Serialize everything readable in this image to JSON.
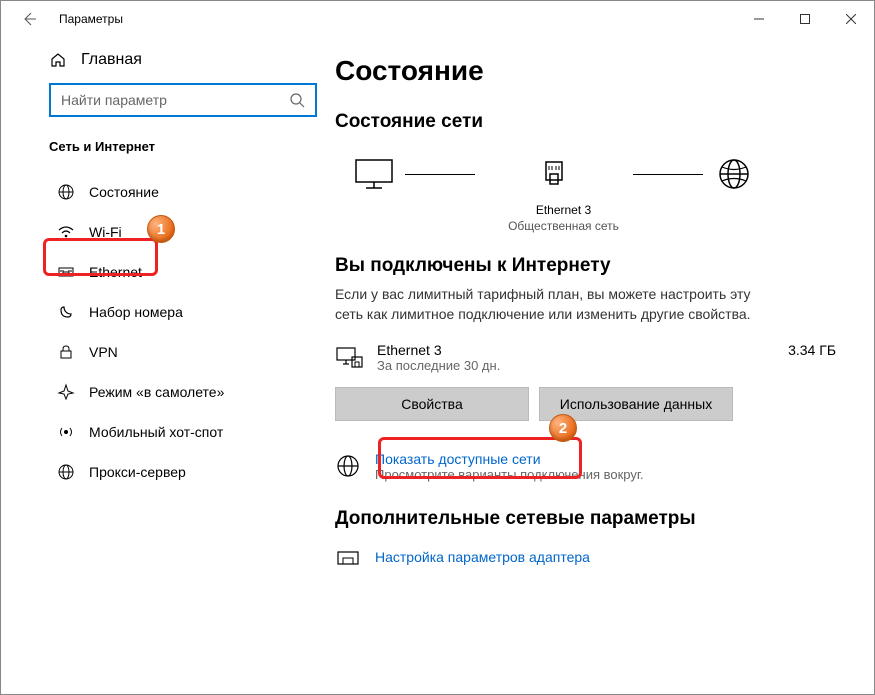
{
  "titlebar": {
    "app_title": "Параметры"
  },
  "sidebar": {
    "home_label": "Главная",
    "search_placeholder": "Найти параметр",
    "section_title": "Сеть и Интернет",
    "items": [
      {
        "label": "Состояние"
      },
      {
        "label": "Wi-Fi"
      },
      {
        "label": "Ethernet"
      },
      {
        "label": "Набор номера"
      },
      {
        "label": "VPN"
      },
      {
        "label": "Режим «в самолете»"
      },
      {
        "label": "Мобильный хот-спот"
      },
      {
        "label": "Прокси-сервер"
      }
    ]
  },
  "main": {
    "page_title": "Состояние",
    "status_title": "Состояние сети",
    "diagram_name": "Ethernet 3",
    "diagram_subtype": "Общественная сеть",
    "connected_title": "Вы подключены к Интернету",
    "description": "Если у вас лимитный тарифный план, вы можете настроить эту сеть как лимитное подключение или изменить другие свойства.",
    "connection": {
      "name": "Ethernet 3",
      "period": "За последние 30 дн.",
      "size": "3.34 ГБ"
    },
    "buttons": {
      "properties": "Свойства",
      "usage": "Использование данных"
    },
    "available": {
      "title": "Показать доступные сети",
      "sub": "Просмотрите варианты подключения вокруг."
    },
    "advanced_title": "Дополнительные сетевые параметры",
    "adapter_link": "Настройка параметров адаптера"
  },
  "annotations": {
    "badge1": "1",
    "badge2": "2"
  }
}
